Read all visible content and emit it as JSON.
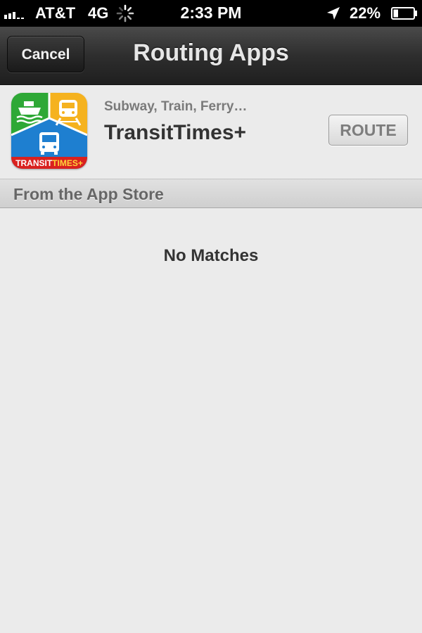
{
  "status_bar": {
    "carrier": "AT&T",
    "network": "4G",
    "time": "2:33 PM",
    "battery_percent": "22%",
    "signal_icon": "signal-bars-icon",
    "activity_icon": "activity-spinner-icon",
    "location_icon": "location-arrow-icon",
    "battery_icon": "battery-icon"
  },
  "nav_bar": {
    "cancel_label": "Cancel",
    "title": "Routing Apps"
  },
  "app_row": {
    "subtitle": "Subway, Train, Ferry…",
    "name": "TransitTimes+",
    "route_label": "ROUTE",
    "icon": {
      "brand_text_white": "TRANSIT",
      "brand_text_accent": "TIMES+",
      "colors": {
        "ferry": "#2ea836",
        "train": "#f5b21f",
        "bus": "#1e7fd0",
        "banner": "#d9211f"
      }
    }
  },
  "section": {
    "title": "From the App Store"
  },
  "empty_state": {
    "text": "No Matches"
  }
}
